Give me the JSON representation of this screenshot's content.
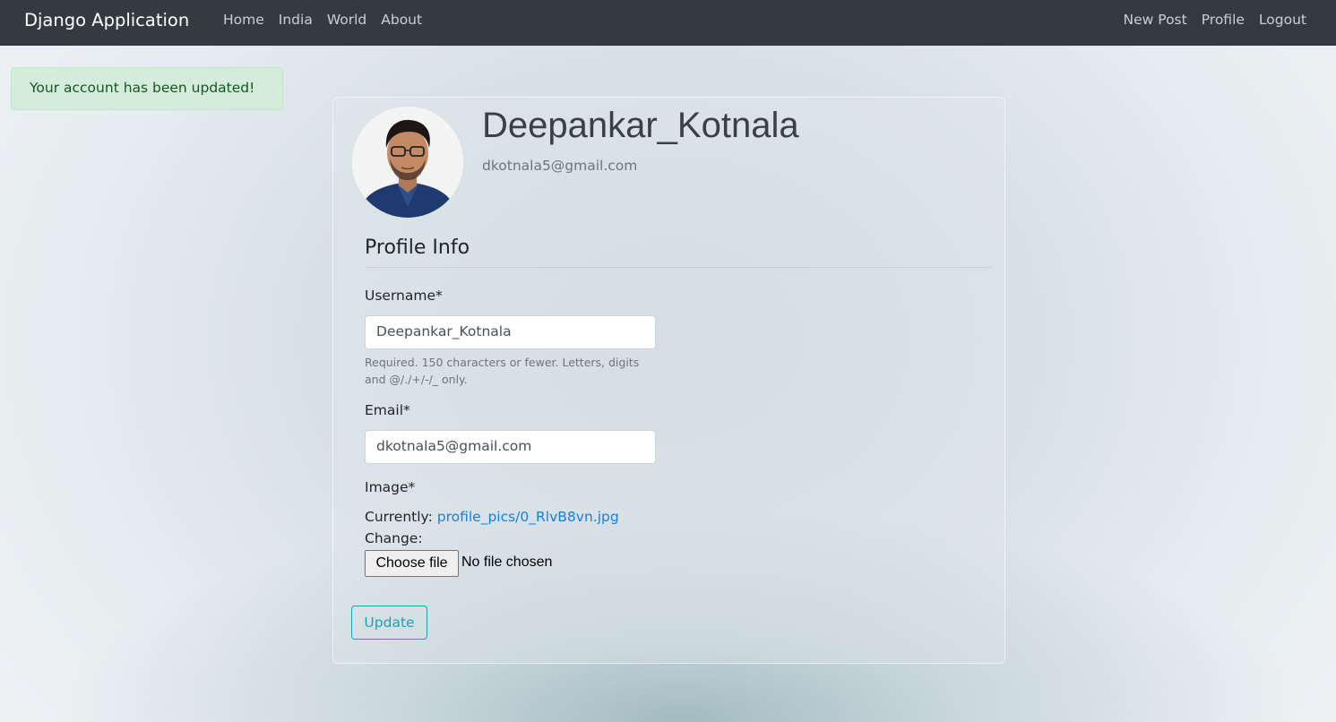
{
  "navbar": {
    "brand": "Django Application",
    "left_links": [
      "Home",
      "India",
      "World",
      "About"
    ],
    "right_links": [
      "New Post",
      "Profile",
      "Logout"
    ]
  },
  "alert": {
    "message": "Your account has been updated!"
  },
  "profile": {
    "avatar_icon": "user-photo-avatar",
    "username": "Deepankar_Kotnala",
    "email": "dkotnala5@gmail.com"
  },
  "form": {
    "legend": "Profile Info",
    "username_label": "Username*",
    "username_value": "Deepankar_Kotnala",
    "username_help": "Required. 150 characters or fewer. Letters, digits and @/./+/-/_ only.",
    "email_label": "Email*",
    "email_value": "dkotnala5@gmail.com",
    "image_label": "Image*",
    "currently_label": "Currently:",
    "current_file": "profile_pics/0_RlvB8vn.jpg",
    "change_label": "Change:",
    "choose_file_label": "Choose file",
    "no_file_text": "No file chosen",
    "submit_label": "Update"
  },
  "colors": {
    "navbar_bg": "#343a40",
    "alert_bg": "#d4edda",
    "alert_text": "#155724",
    "link": "#1a7fd6",
    "update_outline": "#17a2b8"
  }
}
